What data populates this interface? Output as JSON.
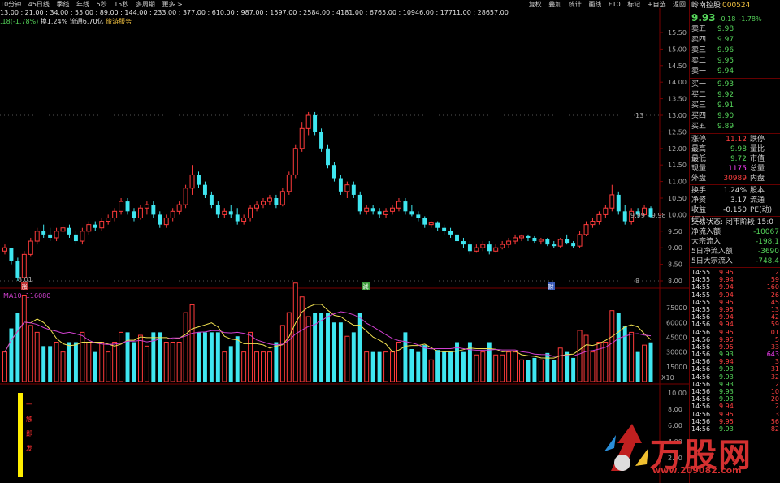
{
  "toolbar": {
    "left": [
      "10分钟",
      "45日线",
      "季线",
      "年线",
      "5秒",
      "15秒",
      "多周期",
      "更多 >"
    ],
    "right": [
      "复权",
      "叠加",
      "统计",
      "画线",
      "F10",
      "标记",
      "+自选",
      "返回"
    ]
  },
  "fib_line": "13.00 : 21.00 : 34.00 : 55.00 : 89.00 : 144.00 : 233.00 : 377.00 : 610.00 : 987.00 : 1597.00 : 2584.00 : 4181.00 : 6765.00 : 10946.00 : 17711.00 : 28657.00",
  "info": {
    "pct": ".18(-1.78%)",
    "turnover": "换1.24%",
    "float": "流通6.70亿",
    "industry": "旅游服务"
  },
  "price_axis": [
    "15.50",
    "15.00",
    "14.50",
    "14.00",
    "13.50",
    "13.00",
    "12.50",
    "12.00",
    "11.50",
    "11.00",
    "10.50",
    "10.00",
    "9.50",
    "9.00",
    "8.50",
    "8.00"
  ],
  "vol_axis": [
    "75000",
    "60000",
    "45000",
    "30000",
    "15000"
  ],
  "vol_unit": "X10",
  "ind_axis": [
    "10.00",
    "8.00",
    "6.00",
    "4.00",
    "2.00"
  ],
  "annotations": {
    "high": "13",
    "low": "8",
    "low_price": "8.01",
    "last": "9.99 - 9.98",
    "ma_label": "MA10: 116080",
    "marks": [
      "涨",
      "減",
      "财"
    ]
  },
  "indicator_text": [
    "一",
    "触",
    "即",
    "发"
  ],
  "chart_data": {
    "type": "candlestick",
    "candles": [
      [
        8.9,
        9.1,
        8.8,
        9.0
      ],
      [
        9.0,
        9.0,
        8.5,
        8.6
      ],
      [
        8.6,
        8.7,
        8.0,
        8.1
      ],
      [
        8.1,
        8.9,
        8.05,
        8.8
      ],
      [
        8.8,
        9.3,
        8.75,
        9.2
      ],
      [
        9.2,
        9.6,
        9.1,
        9.5
      ],
      [
        9.5,
        9.7,
        9.3,
        9.4
      ],
      [
        9.4,
        9.6,
        9.2,
        9.3
      ],
      [
        9.3,
        9.6,
        9.2,
        9.5
      ],
      [
        9.5,
        9.7,
        9.4,
        9.6
      ],
      [
        9.6,
        9.7,
        9.3,
        9.4
      ],
      [
        9.4,
        9.5,
        9.1,
        9.2
      ],
      [
        9.2,
        9.6,
        9.1,
        9.5
      ],
      [
        9.5,
        9.8,
        9.4,
        9.7
      ],
      [
        9.7,
        9.8,
        9.5,
        9.6
      ],
      [
        9.6,
        9.9,
        9.5,
        9.8
      ],
      [
        9.8,
        10.0,
        9.7,
        9.9
      ],
      [
        9.9,
        10.2,
        9.8,
        10.1
      ],
      [
        10.1,
        10.5,
        10.0,
        10.4
      ],
      [
        10.4,
        10.5,
        10.0,
        10.1
      ],
      [
        10.1,
        10.2,
        9.8,
        9.9
      ],
      [
        9.9,
        10.3,
        9.85,
        10.2
      ],
      [
        10.2,
        10.4,
        10.0,
        10.3
      ],
      [
        10.3,
        10.4,
        9.9,
        10.0
      ],
      [
        10.0,
        10.1,
        9.6,
        9.7
      ],
      [
        9.7,
        10.0,
        9.6,
        9.9
      ],
      [
        9.9,
        10.2,
        9.8,
        10.1
      ],
      [
        10.1,
        10.4,
        10.0,
        10.3
      ],
      [
        10.3,
        10.9,
        10.2,
        10.8
      ],
      [
        10.8,
        11.5,
        10.6,
        11.2
      ],
      [
        11.2,
        11.3,
        10.8,
        10.9
      ],
      [
        10.9,
        11.0,
        10.5,
        10.6
      ],
      [
        10.6,
        10.7,
        10.2,
        10.3
      ],
      [
        10.3,
        10.4,
        9.9,
        10.0
      ],
      [
        10.0,
        10.2,
        9.9,
        10.1
      ],
      [
        10.1,
        10.3,
        9.9,
        10.0
      ],
      [
        10.0,
        10.2,
        9.7,
        9.8
      ],
      [
        9.8,
        10.0,
        9.7,
        9.9
      ],
      [
        9.9,
        10.3,
        9.8,
        10.2
      ],
      [
        10.2,
        10.4,
        10.1,
        10.3
      ],
      [
        10.3,
        10.5,
        10.2,
        10.4
      ],
      [
        10.4,
        10.6,
        10.3,
        10.5
      ],
      [
        10.5,
        10.6,
        10.2,
        10.3
      ],
      [
        10.3,
        10.8,
        10.25,
        10.7
      ],
      [
        10.7,
        11.3,
        10.6,
        11.2
      ],
      [
        11.2,
        12.1,
        11.1,
        12.0
      ],
      [
        12.0,
        12.8,
        11.9,
        12.6
      ],
      [
        12.6,
        13.1,
        12.4,
        13.0
      ],
      [
        13.0,
        13.1,
        12.4,
        12.5
      ],
      [
        12.5,
        12.6,
        11.9,
        12.0
      ],
      [
        12.0,
        12.1,
        11.4,
        11.5
      ],
      [
        11.5,
        11.6,
        11.0,
        11.1
      ],
      [
        11.1,
        11.2,
        10.6,
        10.7
      ],
      [
        10.7,
        11.0,
        10.5,
        10.9
      ],
      [
        10.9,
        11.0,
        10.5,
        10.6
      ],
      [
        10.6,
        10.7,
        10.0,
        10.1
      ],
      [
        10.1,
        10.3,
        10.0,
        10.2
      ],
      [
        10.2,
        10.3,
        10.0,
        10.1
      ],
      [
        10.1,
        10.2,
        9.9,
        10.0
      ],
      [
        10.0,
        10.2,
        9.9,
        10.1
      ],
      [
        10.1,
        10.3,
        10.0,
        10.2
      ],
      [
        10.2,
        10.5,
        10.1,
        10.4
      ],
      [
        10.4,
        10.5,
        10.0,
        10.1
      ],
      [
        10.1,
        10.3,
        9.95,
        10.0
      ],
      [
        10.0,
        10.1,
        9.8,
        9.9
      ],
      [
        9.9,
        9.95,
        9.6,
        9.7
      ],
      [
        9.7,
        9.8,
        9.6,
        9.75
      ],
      [
        9.75,
        9.8,
        9.5,
        9.6
      ],
      [
        9.6,
        9.7,
        9.4,
        9.5
      ],
      [
        9.5,
        9.6,
        9.3,
        9.4
      ],
      [
        9.4,
        9.5,
        9.1,
        9.2
      ],
      [
        9.2,
        9.3,
        9.0,
        9.1
      ],
      [
        9.1,
        9.2,
        8.8,
        8.9
      ],
      [
        8.9,
        9.1,
        8.85,
        9.0
      ],
      [
        9.0,
        9.2,
        8.9,
        9.1
      ],
      [
        9.1,
        9.2,
        8.8,
        8.9
      ],
      [
        8.9,
        9.1,
        8.85,
        9.0
      ],
      [
        9.0,
        9.2,
        8.95,
        9.1
      ],
      [
        9.1,
        9.3,
        9.0,
        9.2
      ],
      [
        9.2,
        9.4,
        9.1,
        9.3
      ],
      [
        9.3,
        9.4,
        9.2,
        9.35
      ],
      [
        9.35,
        9.4,
        9.2,
        9.3
      ],
      [
        9.3,
        9.35,
        9.15,
        9.2
      ],
      [
        9.2,
        9.3,
        9.1,
        9.25
      ],
      [
        9.25,
        9.3,
        9.05,
        9.1
      ],
      [
        9.1,
        9.2,
        9.0,
        9.05
      ],
      [
        9.05,
        9.3,
        9.0,
        9.25
      ],
      [
        9.25,
        9.4,
        9.1,
        9.15
      ],
      [
        9.15,
        9.2,
        9.0,
        9.05
      ],
      [
        9.05,
        9.5,
        9.0,
        9.4
      ],
      [
        9.4,
        9.8,
        9.35,
        9.7
      ],
      [
        9.7,
        9.9,
        9.6,
        9.8
      ],
      [
        9.8,
        10.1,
        9.7,
        10.0
      ],
      [
        10.0,
        10.3,
        9.9,
        10.2
      ],
      [
        10.2,
        10.9,
        10.1,
        10.6
      ],
      [
        10.6,
        10.7,
        10.0,
        10.1
      ],
      [
        10.1,
        10.3,
        9.7,
        9.8
      ],
      [
        9.8,
        10.2,
        9.7,
        10.1
      ],
      [
        10.1,
        10.2,
        9.9,
        10.0
      ],
      [
        10.0,
        10.3,
        9.95,
        10.2
      ],
      [
        10.2,
        10.25,
        9.9,
        9.93
      ]
    ]
  },
  "right": {
    "name": "岭南控股",
    "code": "000524",
    "price": "9.93",
    "change": "-0.18",
    "pct": "-1.78%",
    "asks": [
      [
        "卖五",
        "9.98"
      ],
      [
        "卖四",
        "9.97"
      ],
      [
        "卖三",
        "9.96"
      ],
      [
        "卖二",
        "9.95"
      ],
      [
        "卖一",
        "9.94"
      ]
    ],
    "bids": [
      [
        "买一",
        "9.93"
      ],
      [
        "买二",
        "9.92"
      ],
      [
        "买三",
        "9.91"
      ],
      [
        "买四",
        "9.90"
      ],
      [
        "买五",
        "9.89"
      ]
    ],
    "stats": [
      [
        "涨停",
        "11.12",
        "跌停",
        "red"
      ],
      [
        "最高",
        "9.98",
        "量比",
        "grn"
      ],
      [
        "最低",
        "9.72",
        "市值",
        "grn"
      ],
      [
        "现量",
        "1175",
        "总量",
        "mag"
      ],
      [
        "外盘",
        "30989",
        "内盘",
        "red"
      ]
    ],
    "stats2": [
      [
        "换手",
        "1.24%",
        "股本"
      ],
      [
        "净资",
        "3.17",
        "流通"
      ],
      [
        "收益(二)",
        "-0.150",
        "PE(动)"
      ]
    ],
    "trade_status": "交易状态: 闭市阶段 15:0",
    "flows": [
      [
        "净流入额",
        "-10067"
      ],
      [
        "大宗流入",
        "-198.1"
      ],
      [
        "5日净流入额",
        "-3690"
      ],
      [
        "5日大宗流入",
        "-748.4"
      ]
    ],
    "ticks": [
      [
        "14:55",
        "9.95",
        "2",
        "r"
      ],
      [
        "14:55",
        "9.94",
        "59",
        "r"
      ],
      [
        "14:55",
        "9.94",
        "160",
        "r"
      ],
      [
        "14:55",
        "9.94",
        "26",
        "r"
      ],
      [
        "14:55",
        "9.95",
        "45",
        "r"
      ],
      [
        "14:55",
        "9.95",
        "13",
        "r"
      ],
      [
        "14:56",
        "9.94",
        "42",
        "r"
      ],
      [
        "14:56",
        "9.94",
        "59",
        "r"
      ],
      [
        "14:56",
        "9.95",
        "101",
        "r"
      ],
      [
        "14:56",
        "9.95",
        "5",
        "r"
      ],
      [
        "14:56",
        "9.95",
        "33",
        "r"
      ],
      [
        "14:56",
        "9.93",
        "643",
        "m"
      ],
      [
        "14:56",
        "9.94",
        "3",
        "r"
      ],
      [
        "14:56",
        "9.93",
        "31",
        "r"
      ],
      [
        "14:56",
        "9.93",
        "32",
        "r"
      ],
      [
        "14:56",
        "9.93",
        "2",
        "r"
      ],
      [
        "14:56",
        "9.93",
        "10",
        "r"
      ],
      [
        "14:56",
        "9.93",
        "20",
        "r"
      ],
      [
        "14:56",
        "9.94",
        "2",
        "r"
      ],
      [
        "14:56",
        "9.95",
        "3",
        "r"
      ],
      [
        "14:56",
        "9.95",
        "56",
        "r"
      ],
      [
        "14:56",
        "9.93",
        "82",
        "r"
      ]
    ]
  },
  "watermark": {
    "text": "万股网",
    "url": "www.209082.com"
  }
}
